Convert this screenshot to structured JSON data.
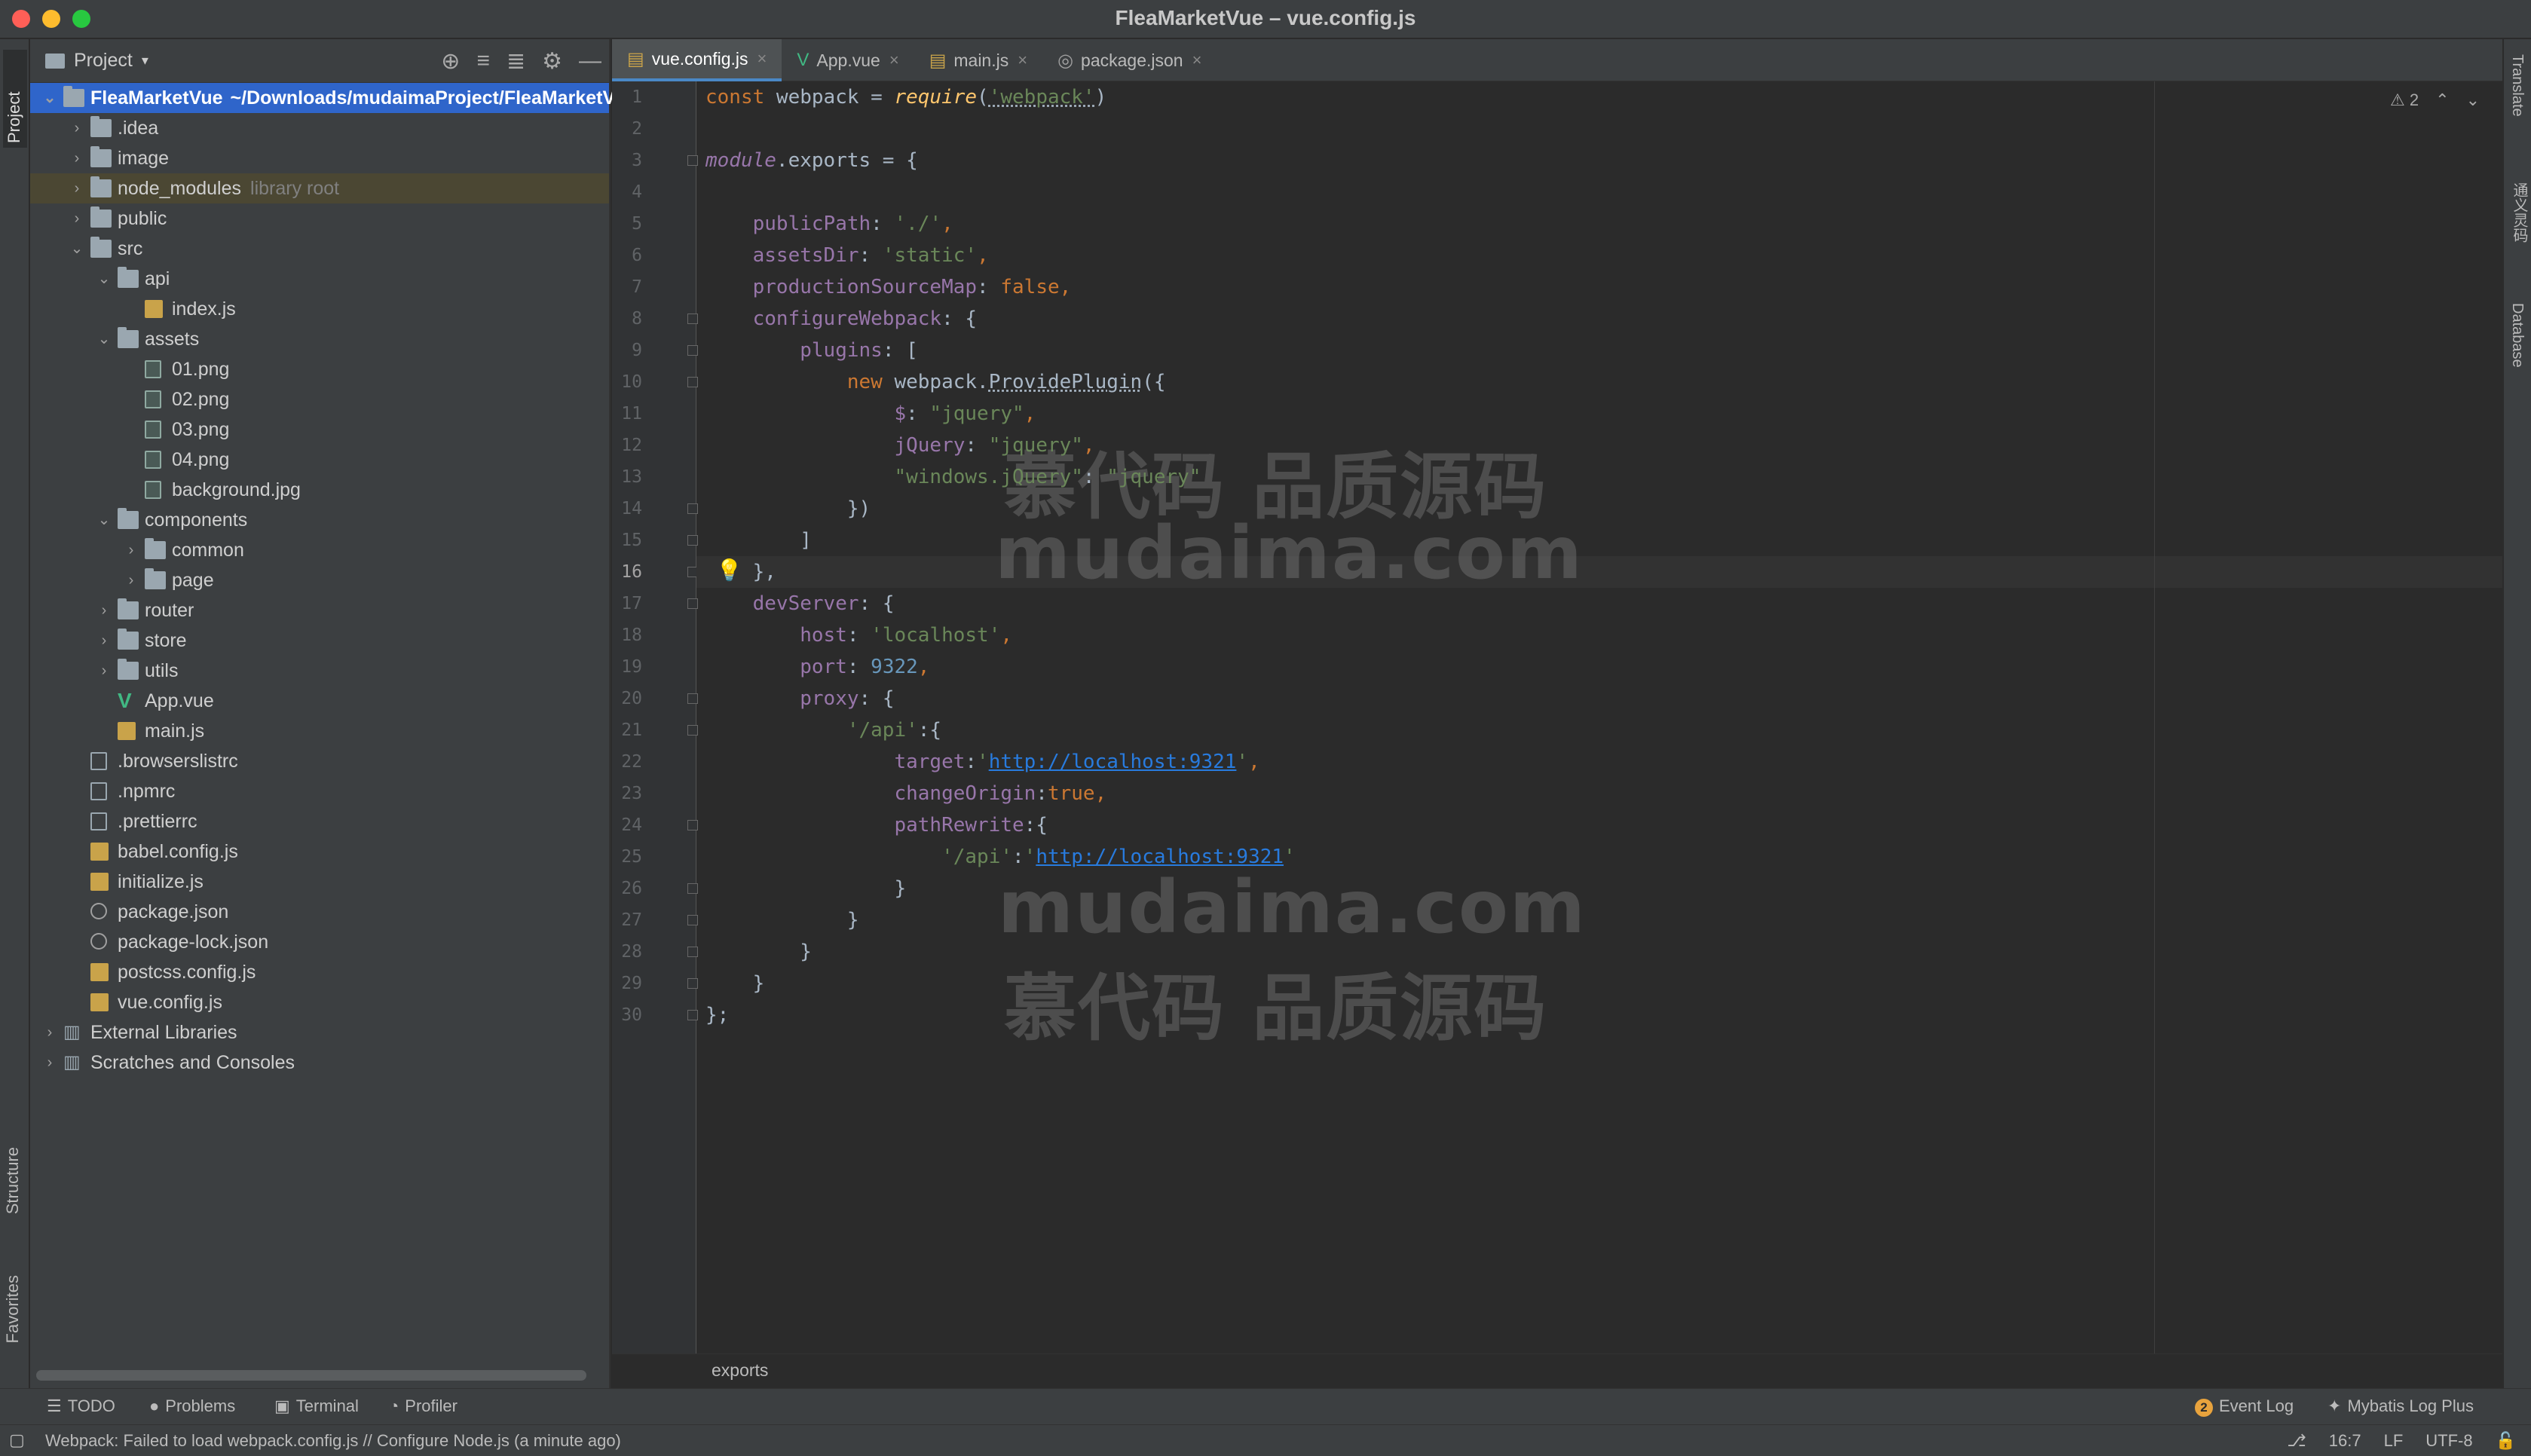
{
  "window": {
    "title": "FleaMarketVue – vue.config.js"
  },
  "left_strip": {
    "project": "Project",
    "structure": "Structure",
    "favorites": "Favorites"
  },
  "right_strip": {
    "translate": "Translate",
    "tongyi": "通义灵码",
    "database": "Database"
  },
  "project_panel": {
    "title": "Project",
    "tree": [
      {
        "label": "FleaMarketVue",
        "hint": "~/Downloads/mudaimaProject/FleaMarketVue",
        "depth": 0,
        "arrow": "open",
        "icon": "folder",
        "selected": true
      },
      {
        "label": ".idea",
        "depth": 1,
        "arrow": "closed",
        "icon": "folder"
      },
      {
        "label": "image",
        "depth": 1,
        "arrow": "closed",
        "icon": "folder"
      },
      {
        "label": "node_modules",
        "hint": "library root",
        "depth": 1,
        "arrow": "closed",
        "icon": "folder",
        "highlight": true
      },
      {
        "label": "public",
        "depth": 1,
        "arrow": "closed",
        "icon": "folder"
      },
      {
        "label": "src",
        "depth": 1,
        "arrow": "open",
        "icon": "folder"
      },
      {
        "label": "api",
        "depth": 2,
        "arrow": "open",
        "icon": "folder"
      },
      {
        "label": "index.js",
        "depth": 3,
        "icon": "js"
      },
      {
        "label": "assets",
        "depth": 2,
        "arrow": "open",
        "icon": "folder"
      },
      {
        "label": "01.png",
        "depth": 3,
        "icon": "img"
      },
      {
        "label": "02.png",
        "depth": 3,
        "icon": "img"
      },
      {
        "label": "03.png",
        "depth": 3,
        "icon": "img"
      },
      {
        "label": "04.png",
        "depth": 3,
        "icon": "img"
      },
      {
        "label": "background.jpg",
        "depth": 3,
        "icon": "img"
      },
      {
        "label": "components",
        "depth": 2,
        "arrow": "open",
        "icon": "folder"
      },
      {
        "label": "common",
        "depth": 3,
        "arrow": "closed",
        "icon": "folder"
      },
      {
        "label": "page",
        "depth": 3,
        "arrow": "closed",
        "icon": "folder"
      },
      {
        "label": "router",
        "depth": 2,
        "arrow": "closed",
        "icon": "folder"
      },
      {
        "label": "store",
        "depth": 2,
        "arrow": "closed",
        "icon": "folder"
      },
      {
        "label": "utils",
        "depth": 2,
        "arrow": "closed",
        "icon": "folder"
      },
      {
        "label": "App.vue",
        "depth": 2,
        "icon": "vue"
      },
      {
        "label": "main.js",
        "depth": 2,
        "icon": "js"
      },
      {
        "label": ".browserslistrc",
        "depth": 1,
        "icon": "file"
      },
      {
        "label": ".npmrc",
        "depth": 1,
        "icon": "file"
      },
      {
        "label": ".prettierrc",
        "depth": 1,
        "icon": "file"
      },
      {
        "label": "babel.config.js",
        "depth": 1,
        "icon": "js"
      },
      {
        "label": "initialize.js",
        "depth": 1,
        "icon": "js"
      },
      {
        "label": "package.json",
        "depth": 1,
        "icon": "json"
      },
      {
        "label": "package-lock.json",
        "depth": 1,
        "icon": "json"
      },
      {
        "label": "postcss.config.js",
        "depth": 1,
        "icon": "js"
      },
      {
        "label": "vue.config.js",
        "depth": 1,
        "icon": "js"
      },
      {
        "label": "External Libraries",
        "depth": 0,
        "arrow": "closed",
        "icon": "lib"
      },
      {
        "label": "Scratches and Consoles",
        "depth": 0,
        "arrow": "closed",
        "icon": "lib"
      }
    ]
  },
  "tabs": [
    {
      "label": "vue.config.js",
      "icon": "js",
      "active": true
    },
    {
      "label": "App.vue",
      "icon": "vue"
    },
    {
      "label": "main.js",
      "icon": "js"
    },
    {
      "label": "package.json",
      "icon": "json"
    }
  ],
  "editor": {
    "current_line": 16,
    "warnings": "2",
    "fold_lines": [
      3,
      8,
      9,
      10,
      14,
      15,
      16,
      17,
      20,
      21,
      24,
      26,
      27,
      28,
      29,
      30
    ],
    "lines": [
      [
        [
          "kw",
          "const "
        ],
        [
          "",
          "webpack = "
        ],
        [
          "fn ital",
          "require"
        ],
        [
          "",
          "("
        ],
        [
          "str under-dot",
          "'webpack'"
        ],
        [
          "",
          ")"
        ]
      ],
      [],
      [
        [
          "prop ital",
          "module"
        ],
        [
          "",
          ".exports = {"
        ]
      ],
      [],
      [
        [
          "",
          "    "
        ],
        [
          "prop",
          "publicPath"
        ],
        [
          "",
          ": "
        ],
        [
          "str",
          "'./'"
        ],
        [
          "kw",
          ","
        ]
      ],
      [
        [
          "",
          "    "
        ],
        [
          "prop",
          "assetsDir"
        ],
        [
          "",
          ": "
        ],
        [
          "str",
          "'static'"
        ],
        [
          "kw",
          ","
        ]
      ],
      [
        [
          "",
          "    "
        ],
        [
          "prop",
          "productionSourceMap"
        ],
        [
          "",
          ": "
        ],
        [
          "kw",
          "false"
        ],
        [
          "kw",
          ","
        ]
      ],
      [
        [
          "",
          "    "
        ],
        [
          "prop",
          "configureWebpack"
        ],
        [
          "",
          ": {"
        ]
      ],
      [
        [
          "",
          "        "
        ],
        [
          "prop",
          "plugins"
        ],
        [
          "",
          ": ["
        ]
      ],
      [
        [
          "",
          "            "
        ],
        [
          "kw",
          "new "
        ],
        [
          "",
          "webpack."
        ],
        [
          "under-dot",
          "ProvidePlugin"
        ],
        [
          "",
          "({"
        ]
      ],
      [
        [
          "",
          "                "
        ],
        [
          "prop",
          "$"
        ],
        [
          "",
          ": "
        ],
        [
          "str",
          "\"jquery\""
        ],
        [
          "kw",
          ","
        ]
      ],
      [
        [
          "",
          "                "
        ],
        [
          "prop",
          "jQuery"
        ],
        [
          "",
          ": "
        ],
        [
          "str",
          "\"jquery\""
        ],
        [
          "kw",
          ","
        ]
      ],
      [
        [
          "",
          "                "
        ],
        [
          "str",
          "\"windows.jQuery\""
        ],
        [
          "",
          ": "
        ],
        [
          "str",
          "\"jquery\""
        ]
      ],
      [
        [
          "",
          "            })"
        ]
      ],
      [
        [
          "",
          "        ]"
        ]
      ],
      [
        [
          "",
          "    },"
        ]
      ],
      [
        [
          "",
          "    "
        ],
        [
          "prop",
          "devServer"
        ],
        [
          "",
          ": {"
        ]
      ],
      [
        [
          "",
          "        "
        ],
        [
          "prop",
          "host"
        ],
        [
          "",
          ": "
        ],
        [
          "str",
          "'localhost'"
        ],
        [
          "kw",
          ","
        ]
      ],
      [
        [
          "",
          "        "
        ],
        [
          "prop",
          "port"
        ],
        [
          "",
          ": "
        ],
        [
          "num",
          "9322"
        ],
        [
          "kw",
          ","
        ]
      ],
      [
        [
          "",
          "        "
        ],
        [
          "prop",
          "proxy"
        ],
        [
          "",
          ": {"
        ]
      ],
      [
        [
          "",
          "            "
        ],
        [
          "str",
          "'/api'"
        ],
        [
          "",
          ":{"
        ]
      ],
      [
        [
          "",
          "                "
        ],
        [
          "prop",
          "target"
        ],
        [
          "",
          ":"
        ],
        [
          "str",
          "'"
        ],
        [
          "str link",
          "http://localhost:9321"
        ],
        [
          "str",
          "'"
        ],
        [
          "kw",
          ","
        ]
      ],
      [
        [
          "",
          "                "
        ],
        [
          "prop",
          "changeOrigin"
        ],
        [
          "",
          ":"
        ],
        [
          "kw",
          "true"
        ],
        [
          "kw",
          ","
        ]
      ],
      [
        [
          "",
          "                "
        ],
        [
          "prop",
          "pathRewrite"
        ],
        [
          "",
          ":{"
        ]
      ],
      [
        [
          "",
          "                    "
        ],
        [
          "str",
          "'/api'"
        ],
        [
          "",
          ":"
        ],
        [
          "str",
          "'"
        ],
        [
          "str link",
          "http://localhost:9321"
        ],
        [
          "str",
          "'"
        ]
      ],
      [
        [
          "",
          "                }"
        ]
      ],
      [
        [
          "",
          "            }"
        ]
      ],
      [
        [
          "",
          "        }"
        ]
      ],
      [
        [
          "",
          "    }"
        ]
      ],
      [
        [
          "",
          "};"
        ]
      ]
    ]
  },
  "watermarks": [
    "慕代码 品质源码",
    "mudaima.com",
    "mudaima.com",
    "慕代码 品质源码"
  ],
  "breadcrumb": "exports",
  "bottom_tools": {
    "todo": "TODO",
    "problems": "Problems",
    "terminal": "Terminal",
    "profiler": "Profiler",
    "event_log_count": "2",
    "event_log": "Event Log",
    "mybatis": "Mybatis Log Plus"
  },
  "status": {
    "message": "Webpack: Failed to load webpack.config.js // Configure Node.js (a minute ago)",
    "position": "16:7",
    "line_sep": "LF",
    "encoding": "UTF-8"
  }
}
